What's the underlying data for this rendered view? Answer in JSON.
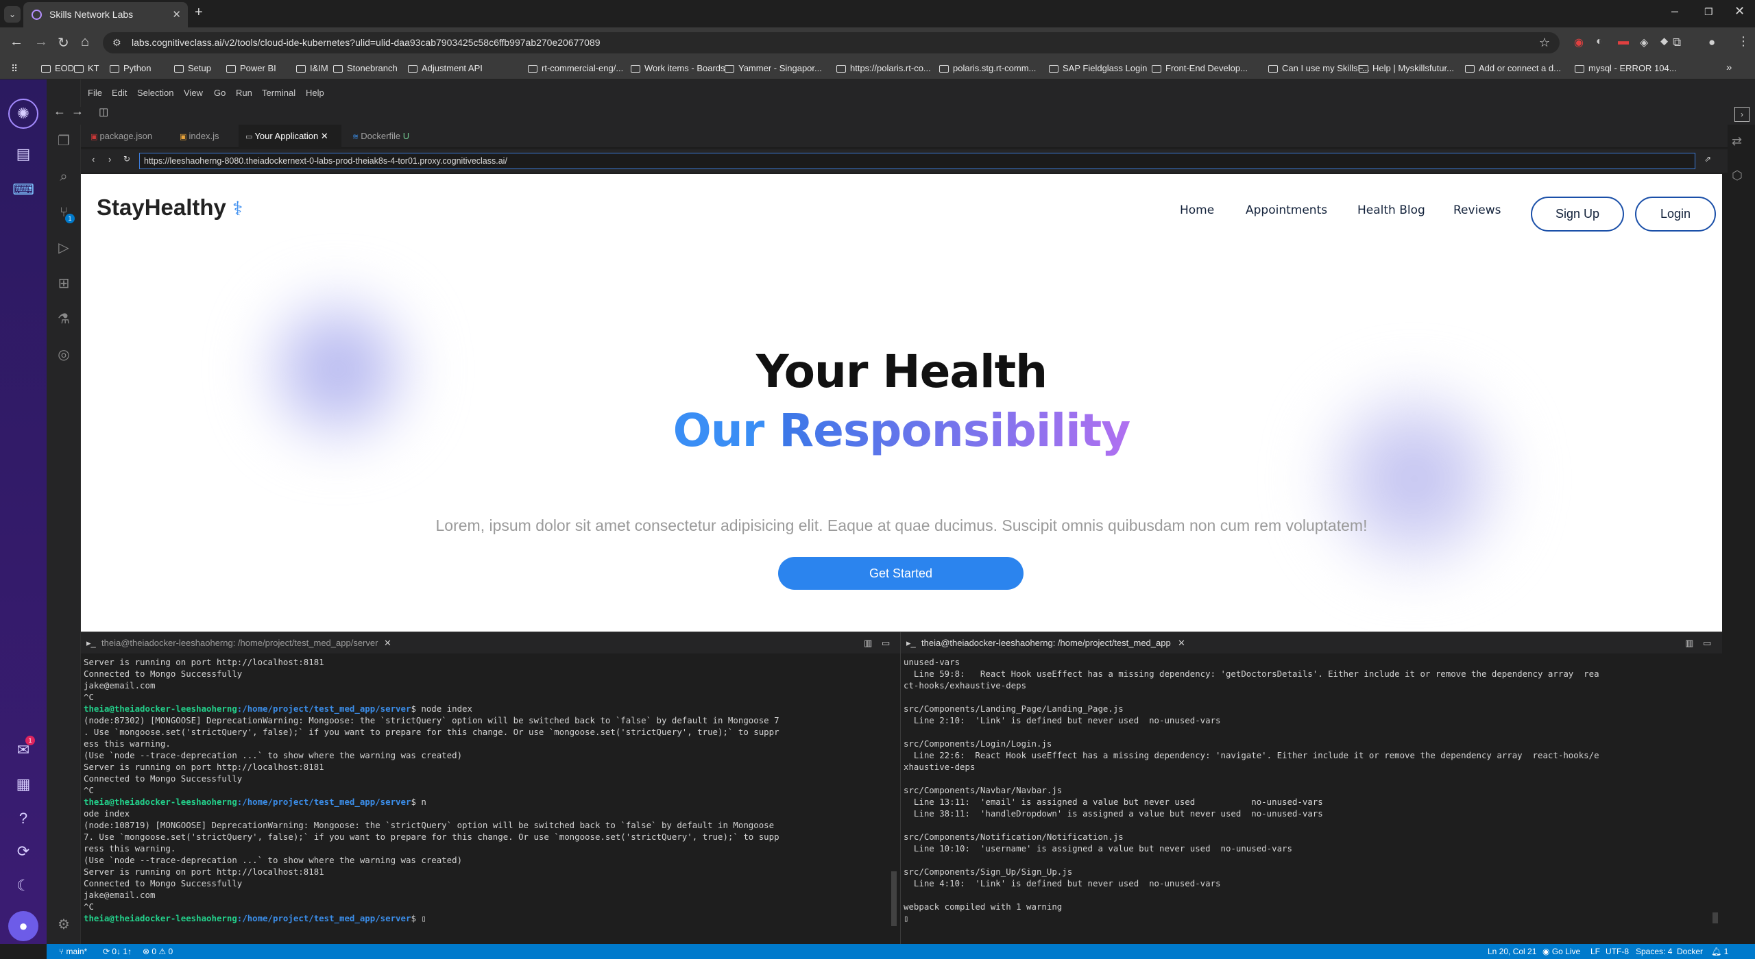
{
  "browser": {
    "tab_title": "Skills Network Labs",
    "url": "labs.cognitiveclass.ai/v2/tools/cloud-ide-kubernetes?ulid=ulid-daa93cab7903425c58c6ffb997ab270e20677089",
    "bookmarks": [
      "EOD",
      "KT",
      "Python",
      "Setup",
      "Power BI",
      "I&IM",
      "Stonebranch",
      "Adjustment API",
      "rt-commercial-eng/...",
      "Work items - Boards",
      "Yammer - Singapor...",
      "https://polaris.rt-co...",
      "polaris.stg.rt-comm...",
      "SAP Fieldglass Login",
      "Front-End Develop...",
      "Can I use my SkillsF...",
      "Help | Myskillsfutur...",
      "Add or connect a d...",
      "mysql - ERROR 104..."
    ]
  },
  "ide": {
    "menu": [
      "File",
      "Edit",
      "Selection",
      "View",
      "Go",
      "Run",
      "Terminal",
      "Help"
    ],
    "editor_tabs": [
      {
        "label": "package.json"
      },
      {
        "label": "index.js"
      },
      {
        "label": "Your Application"
      },
      {
        "label": "Dockerfile",
        "badge": "U"
      }
    ],
    "preview_url": "https://leeshaoherng-8080.theiadockernext-0-labs-prod-theiak8s-4-tor01.proxy.cognitiveclass.ai/",
    "scm_badge": "1",
    "notif_badge": "1"
  },
  "app": {
    "brand": "StayHealthy",
    "nav": [
      "Home",
      "Appointments",
      "Health Blog",
      "Reviews"
    ],
    "signup": "Sign Up",
    "login": "Login",
    "hero_line1": "Your Health",
    "hero_word_a": "Our",
    "hero_word_b": "Responsibility",
    "lorem": "Lorem, ipsum dolor sit amet consectetur adipisicing elit. Eaque at quae ducimus. Suscipit omnis quibusdam non cum rem voluptatem!",
    "cta": "Get Started"
  },
  "terminal_left": {
    "title": "theia@theiadocker-leeshaoherng: /home/project/test_med_app/server",
    "lines": [
      {
        "t": "Server is running on port http://localhost:8181"
      },
      {
        "t": "Connected to Mongo Successfully"
      },
      {
        "t": "jake@email.com"
      },
      {
        "t": "^C"
      },
      {
        "p": "theia@theiadocker-leeshaoherng",
        "d": ":/home/project/test_med_app/server",
        "c": "$ node index"
      },
      {
        "t": "(node:87302) [MONGOOSE] DeprecationWarning: Mongoose: the `strictQuery` option will be switched back to `false` by default in Mongoose 7"
      },
      {
        "t": ". Use `mongoose.set('strictQuery', false);` if you want to prepare for this change. Or use `mongoose.set('strictQuery', true);` to suppr"
      },
      {
        "t": "ess this warning."
      },
      {
        "t": "(Use `node --trace-deprecation ...` to show where the warning was created)"
      },
      {
        "t": "Server is running on port http://localhost:8181"
      },
      {
        "t": "Connected to Mongo Successfully"
      },
      {
        "t": "^C"
      },
      {
        "p": "theia@theiadocker-leeshaoherng",
        "d": ":/home/project/test_med_app/server",
        "c": "$ n"
      },
      {
        "t": "ode index"
      },
      {
        "t": "(node:108719) [MONGOOSE] DeprecationWarning: Mongoose: the `strictQuery` option will be switched back to `false` by default in Mongoose"
      },
      {
        "t": "7. Use `mongoose.set('strictQuery', false);` if you want to prepare for this change. Or use `mongoose.set('strictQuery', true);` to supp"
      },
      {
        "t": "ress this warning."
      },
      {
        "t": "(Use `node --trace-deprecation ...` to show where the warning was created)"
      },
      {
        "t": "Server is running on port http://localhost:8181"
      },
      {
        "t": "Connected to Mongo Successfully"
      },
      {
        "t": "jake@email.com"
      },
      {
        "t": "^C"
      },
      {
        "p": "theia@theiadocker-leeshaoherng",
        "d": ":/home/project/test_med_app/server",
        "c": "$ ▯"
      }
    ]
  },
  "terminal_right": {
    "title": "theia@theiadocker-leeshaoherng: /home/project/test_med_app",
    "lines": [
      "unused-vars",
      "  Line 59:8:   React Hook useEffect has a missing dependency: 'getDoctorsDetails'. Either include it or remove the dependency array  rea",
      "ct-hooks/exhaustive-deps",
      "",
      "src/Components/Landing_Page/Landing_Page.js",
      "  Line 2:10:  'Link' is defined but never used  no-unused-vars",
      "",
      "src/Components/Login/Login.js",
      "  Line 22:6:  React Hook useEffect has a missing dependency: 'navigate'. Either include it or remove the dependency array  react-hooks/e",
      "xhaustive-deps",
      "",
      "src/Components/Navbar/Navbar.js",
      "  Line 13:11:  'email' is assigned a value but never used           no-unused-vars",
      "  Line 38:11:  'handleDropdown' is assigned a value but never used  no-unused-vars",
      "",
      "src/Components/Notification/Notification.js",
      "  Line 10:10:  'username' is assigned a value but never used  no-unused-vars",
      "",
      "src/Components/Sign_Up/Sign_Up.js",
      "  Line 4:10:  'Link' is defined but never used  no-unused-vars",
      "",
      "webpack compiled with 1 warning",
      "▯"
    ]
  },
  "statusbar": {
    "branch": "main*",
    "sync": "0↓ 1↑",
    "problems": "⊗ 0 ⚠ 0",
    "position": "Ln 20, Col 21",
    "golive": "Go Live",
    "eol": "LF",
    "encoding": "UTF-8",
    "spaces": "Spaces: 4",
    "lang": "Docker",
    "notif": "1"
  },
  "colors": {
    "accent_blue": "#2b84ee",
    "gradient_start": "#3a8ef5",
    "gradient_end": "#b070f0",
    "status_bar": "#007acc",
    "prompt_green": "#23d18b",
    "prompt_blue": "#3b8eea"
  }
}
